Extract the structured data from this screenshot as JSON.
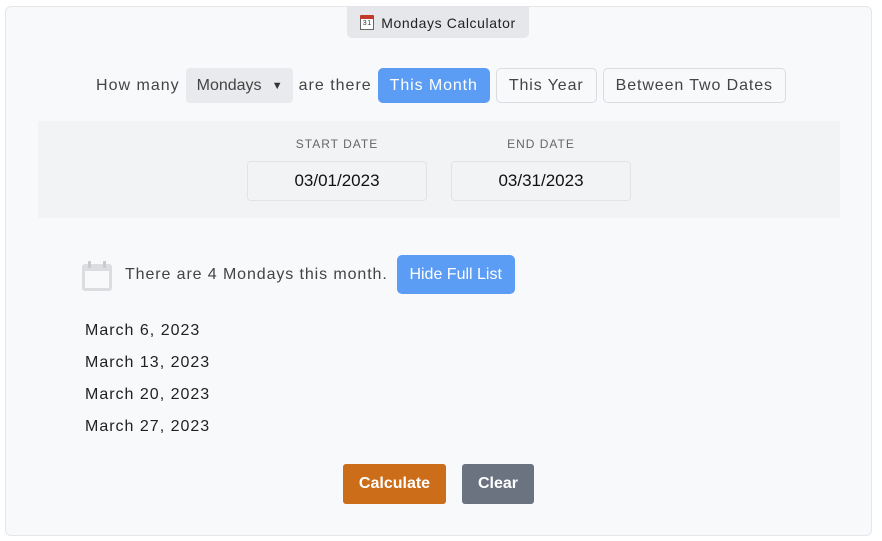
{
  "app": {
    "title": "Mondays Calculator",
    "title_icon": "calendar-31-icon",
    "title_icon_text": "31"
  },
  "query": {
    "prefix": "How many",
    "day_select": {
      "selected": "Mondays",
      "chevron": "⌄"
    },
    "middle": "are there",
    "modes": [
      {
        "label": "This Month",
        "active": true
      },
      {
        "label": "This Year",
        "active": false
      },
      {
        "label": "Between Two Dates",
        "active": false
      }
    ]
  },
  "dates": {
    "start_label": "START DATE",
    "start_value": "03/01/2023",
    "end_label": "END DATE",
    "end_value": "03/31/2023"
  },
  "result": {
    "icon": "calendar-icon",
    "text": "There are 4 Mondays this month.",
    "toggle_label": "Hide Full List",
    "items": [
      "March 6, 2023",
      "March 13, 2023",
      "March 20, 2023",
      "March 27, 2023"
    ]
  },
  "actions": {
    "calculate_label": "Calculate",
    "clear_label": "Clear"
  },
  "colors": {
    "accent_blue": "#5b9cf4",
    "calculate_orange": "#cc6d19",
    "clear_gray": "#6b7280"
  }
}
